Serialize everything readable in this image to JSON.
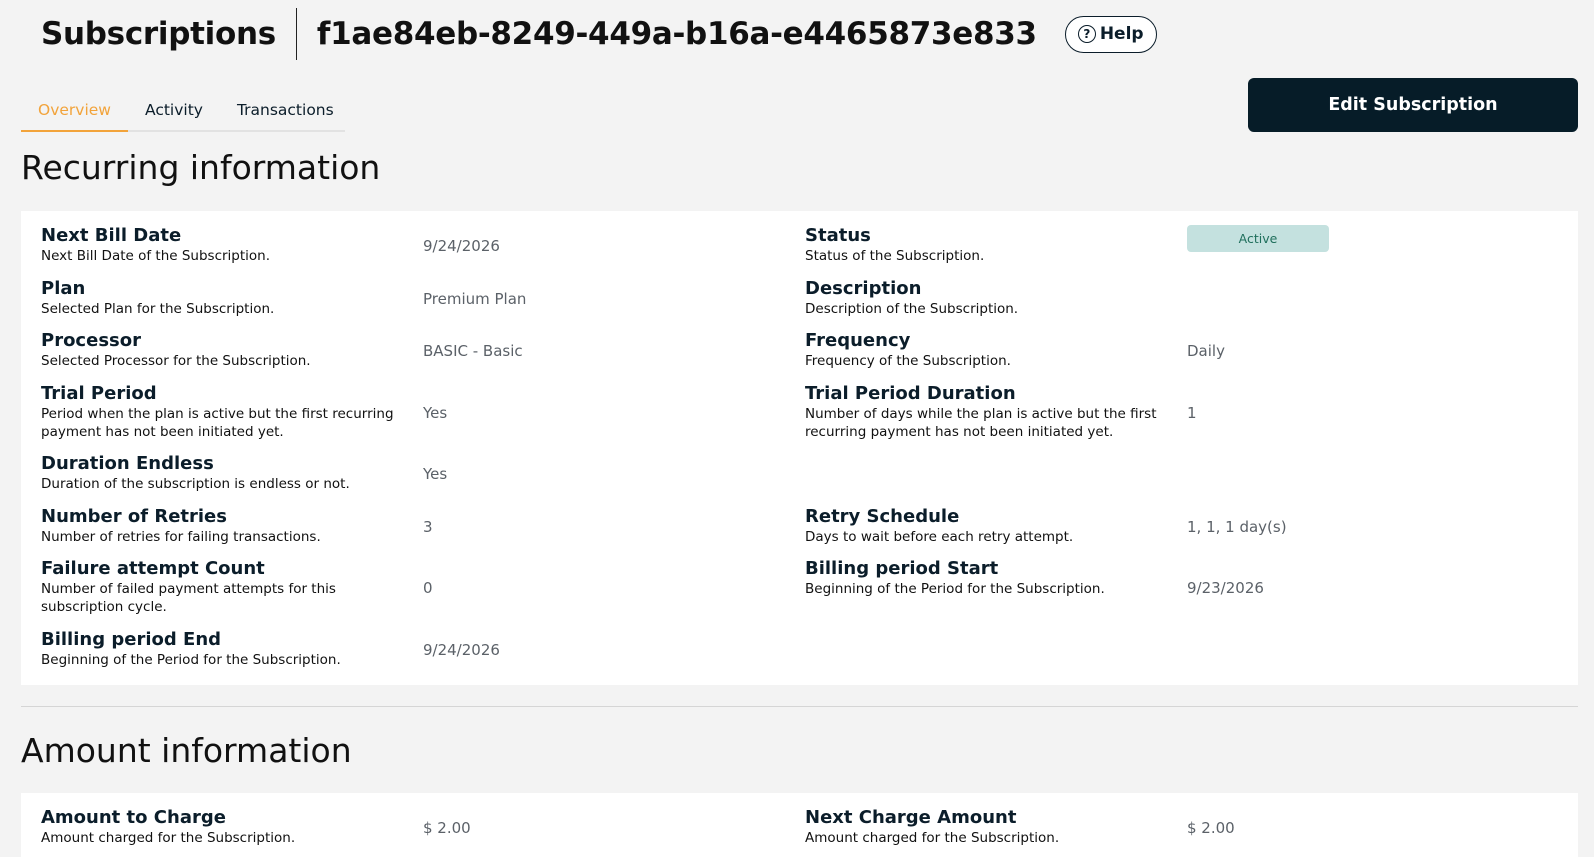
{
  "header": {
    "title": "Subscriptions",
    "subscription_id": "f1ae84eb-8249-449a-b16a-e4465873e833",
    "help_label": "Help"
  },
  "tabs": [
    {
      "label": "Overview",
      "active": true
    },
    {
      "label": "Activity",
      "active": false
    },
    {
      "label": "Transactions",
      "active": false
    }
  ],
  "edit_button_label": "Edit Subscription",
  "recurring": {
    "title": "Recurring information",
    "next_bill_date": {
      "label": "Next Bill Date",
      "desc": "Next Bill Date of the Subscription.",
      "value": "9/24/2026"
    },
    "status": {
      "label": "Status",
      "desc": "Status of the Subscription.",
      "value": "Active"
    },
    "plan": {
      "label": "Plan",
      "desc": "Selected Plan for the Subscription.",
      "value": "Premium Plan"
    },
    "description": {
      "label": "Description",
      "desc": "Description of the Subscription.",
      "value": ""
    },
    "processor": {
      "label": "Processor",
      "desc": "Selected Processor for the Subscription.",
      "value": "BASIC - Basic"
    },
    "frequency": {
      "label": "Frequency",
      "desc": "Frequency of the Subscription.",
      "value": "Daily"
    },
    "trial_period": {
      "label": "Trial Period",
      "desc": "Period when the plan is active but the first recurring payment has not been initiated yet.",
      "value": "Yes"
    },
    "trial_duration": {
      "label": "Trial Period Duration",
      "desc": "Number of days while the plan is active but the first recurring payment has not been initiated yet.",
      "value": "1"
    },
    "duration_endless": {
      "label": "Duration Endless",
      "desc": "Duration of the subscription is endless or not.",
      "value": "Yes"
    },
    "retries": {
      "label": "Number of Retries",
      "desc": "Number of retries for failing transactions.",
      "value": "3"
    },
    "retry_schedule": {
      "label": "Retry Schedule",
      "desc": "Days to wait before each retry attempt.",
      "value": "1, 1, 1 day(s)"
    },
    "failure_count": {
      "label": "Failure attempt Count",
      "desc": "Number of failed payment attempts for this subscription cycle.",
      "value": "0"
    },
    "billing_start": {
      "label": "Billing period Start",
      "desc": "Beginning of the Period for the Subscription.",
      "value": "9/23/2026"
    },
    "billing_end": {
      "label": "Billing period End",
      "desc": "Beginning of the Period for the Subscription.",
      "value": "9/24/2026"
    }
  },
  "amount": {
    "title": "Amount information",
    "amount_to_charge": {
      "label": "Amount to Charge",
      "desc": "Amount charged for the Subscription.",
      "value": "$ 2.00"
    },
    "next_charge_amount": {
      "label": "Next Charge Amount",
      "desc": "Amount charged for the Subscription.",
      "value": "$ 2.00"
    }
  },
  "colors": {
    "primary": "#061c28",
    "accent": "#f2a33a",
    "status_bg": "#c4e1df",
    "status_text": "#1f6f5c"
  }
}
